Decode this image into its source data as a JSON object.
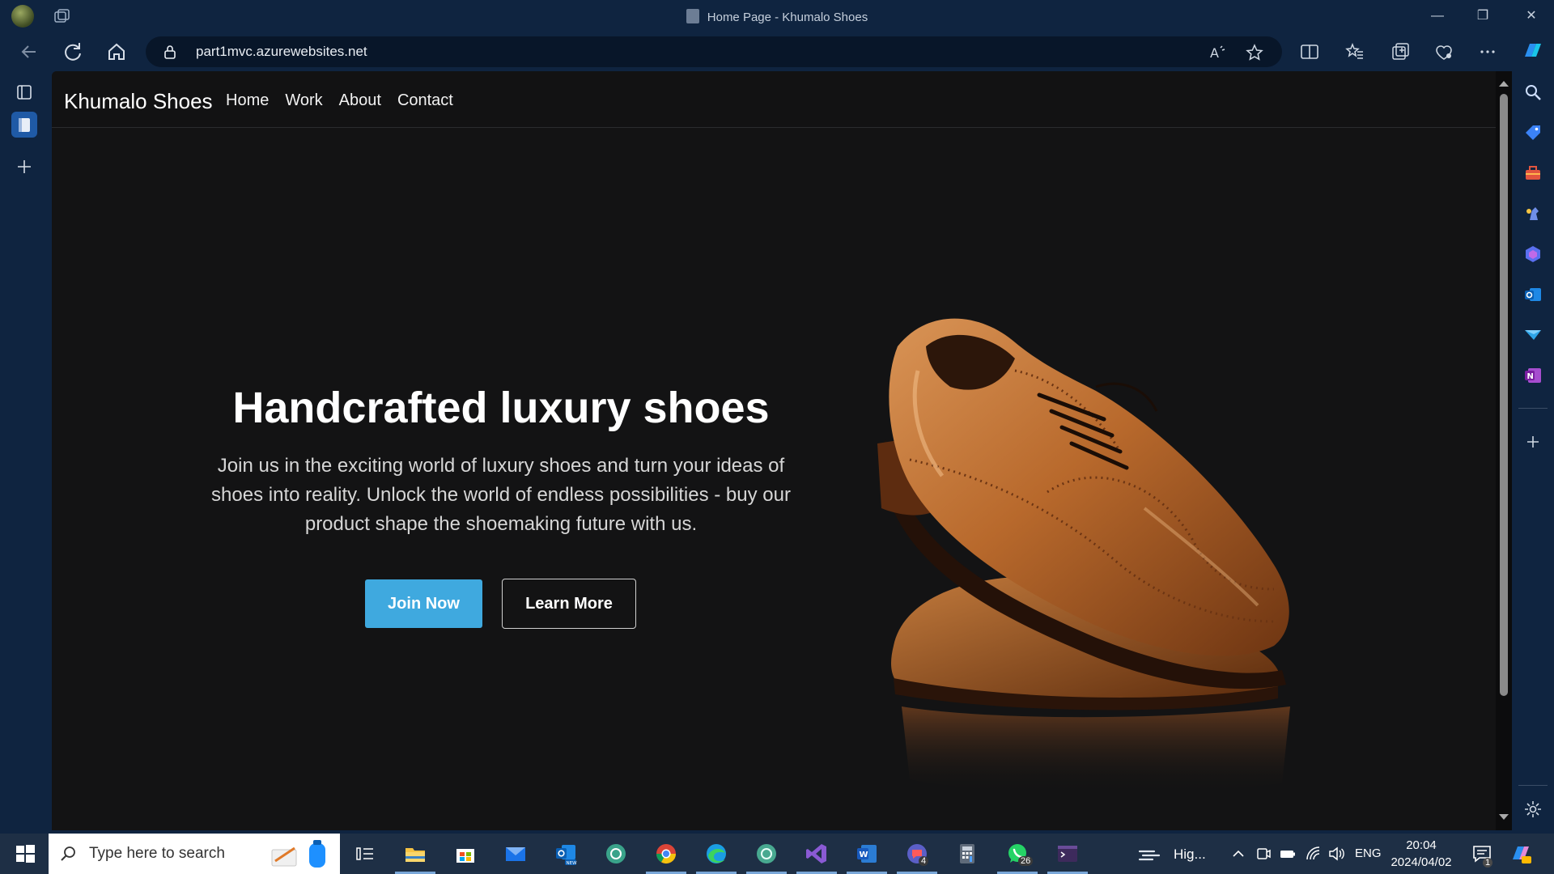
{
  "browser": {
    "window_title": "Home Page - Khumalo Shoes",
    "url": "part1mvc.azurewebsites.net"
  },
  "site": {
    "brand": "Khumalo Shoes",
    "nav": [
      "Home",
      "Work",
      "About",
      "Contact"
    ],
    "hero": {
      "title": "Handcrafted luxury shoes",
      "text": "Join us in the exciting world of luxury shoes and turn your ideas of shoes into reality. Unlock the world of endless possibilities - buy our product shape the shoemaking future with us.",
      "primary_button": "Join Now",
      "secondary_button": "Learn More"
    }
  },
  "taskbar": {
    "search_placeholder": "Type here to search",
    "weather": "Hig...",
    "language": "ENG",
    "time": "20:04",
    "date": "2024/04/02",
    "whatsapp_badge": "26",
    "app_badge": "4",
    "notification_badge": "1"
  },
  "colors": {
    "accent": "#3fa9df",
    "page_bg": "#131314",
    "frame_bg": "#0f2440"
  }
}
